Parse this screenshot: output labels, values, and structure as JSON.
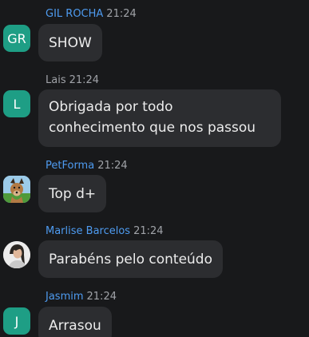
{
  "colors": {
    "background": "#18191b",
    "bubble": "#2c2d30",
    "bubble_text": "#ececec",
    "timestamp": "#a0a3a8",
    "avatar_teal": "#1e9e85"
  },
  "messages": [
    {
      "name": "GIL ROCHA",
      "name_color": "#4e9bf0",
      "time": "21:24",
      "avatar_initials": "GR",
      "avatar_type": "initials",
      "text": "SHOW"
    },
    {
      "name": "Lais",
      "name_color": "#a0a3a8",
      "time": "21:24",
      "avatar_initials": "L",
      "avatar_type": "initials",
      "text_lines": [
        "Obrigada por todo",
        "conhecimento que nos passou"
      ]
    },
    {
      "name": "PetForma",
      "name_color": "#4e9bf0",
      "time": "21:24",
      "avatar_type": "image",
      "avatar_icon": "dog-photo-icon",
      "text": "Top d+"
    },
    {
      "name": "Marlise Barcelos",
      "name_color": "#4e9bf0",
      "time": "21:24",
      "avatar_type": "image",
      "avatar_icon": "person-photo-icon",
      "text": "Parabéns pelo conteúdo"
    },
    {
      "name": "Jasmim",
      "name_color": "#4e9bf0",
      "time": "21:24",
      "avatar_initials": "J",
      "avatar_type": "initials",
      "text": "Arrasou"
    }
  ]
}
